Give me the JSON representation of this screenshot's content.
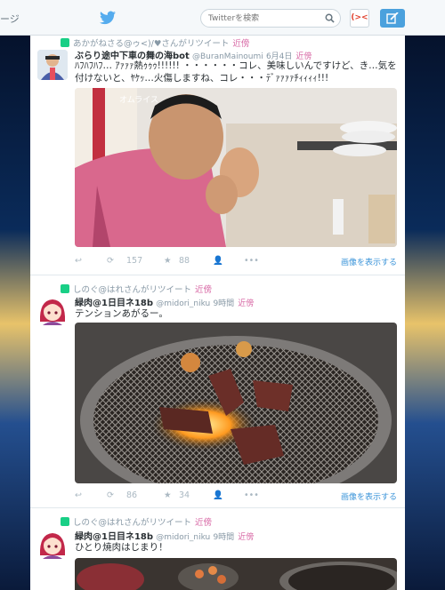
{
  "topbar": {
    "home_text": "ージ",
    "search_placeholder": "Twitterを検索",
    "dm_label": "(><"
  },
  "tweets": [
    {
      "retweeted_by": "あかがねさる@ゥ<)/♥さんがリツイート",
      "kinbo": "近傍",
      "name": "ぶらり途中下車の舞の海bot",
      "handle": "@BuranMainoumi",
      "time": "6月4日",
      "text": "ﾊﾌﾊﾌﾊﾌ… ｱｧｧｧ熱ｩｩｩ!!!!!! ・・・・・・コレ、美味しいんですけど、き…気を付けないと、ﾔｹｯ…火傷しますね、コレ・・・ﾃﾞｧｧｧｧﾁｨｨｨｨ!!!",
      "media_caption": "オムライス",
      "actions": {
        "retweets": "157",
        "favorites": "88",
        "show_media": "画像を表示する"
      }
    },
    {
      "retweeted_by": "しのぐ@はれさんがリツイート",
      "kinbo": "近傍",
      "name": "緑肉@1日目ネ18b",
      "handle": "@midori_niku",
      "time": "9時間",
      "text": "テンションあがるー。",
      "actions": {
        "retweets": "86",
        "favorites": "34",
        "show_media": "画像を表示する"
      }
    },
    {
      "retweeted_by": "しのぐ@はれさんがリツイート",
      "kinbo": "近傍",
      "name": "緑肉@1日目ネ18b",
      "handle": "@midori_niku",
      "time": "9時間",
      "text": "ひとり焼肉はじまり！"
    }
  ]
}
